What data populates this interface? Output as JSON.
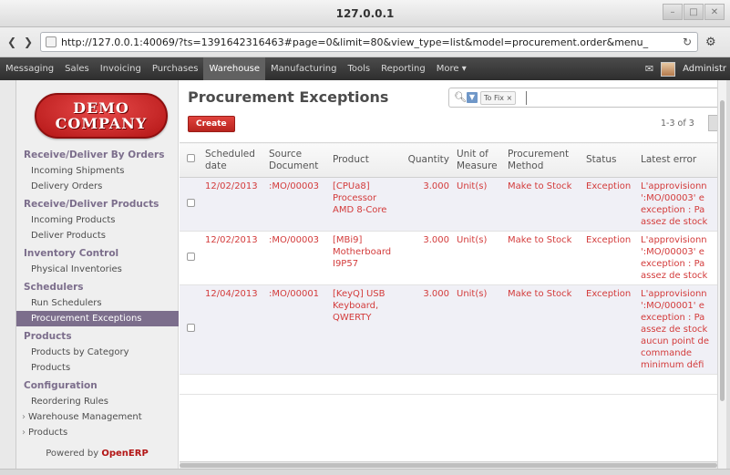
{
  "window": {
    "title": "127.0.0.1"
  },
  "browser": {
    "url": "http://127.0.0.1:40069/?ts=1391642316463#page=0&limit=80&view_type=list&model=procurement.order&menu_"
  },
  "topmenu": {
    "items": [
      {
        "label": "Messaging",
        "active": false
      },
      {
        "label": "Sales",
        "active": false
      },
      {
        "label": "Invoicing",
        "active": false
      },
      {
        "label": "Purchases",
        "active": false
      },
      {
        "label": "Warehouse",
        "active": true
      },
      {
        "label": "Manufacturing",
        "active": false
      },
      {
        "label": "Tools",
        "active": false
      },
      {
        "label": "Reporting",
        "active": false
      },
      {
        "label": "More ▾",
        "active": false
      }
    ],
    "user": "Administr"
  },
  "logo": {
    "line1": "DEMO",
    "line2": "COMPANY"
  },
  "sidebar": {
    "sections": [
      {
        "title": "Receive/Deliver By Orders",
        "items": [
          {
            "label": "Incoming Shipments"
          },
          {
            "label": "Delivery Orders"
          }
        ]
      },
      {
        "title": "Receive/Deliver Products",
        "items": [
          {
            "label": "Incoming Products"
          },
          {
            "label": "Deliver Products"
          }
        ]
      },
      {
        "title": "Inventory Control",
        "items": [
          {
            "label": "Physical Inventories"
          }
        ]
      },
      {
        "title": "Schedulers",
        "items": [
          {
            "label": "Run Schedulers"
          },
          {
            "label": "Procurement Exceptions",
            "active": true
          }
        ]
      },
      {
        "title": "Products",
        "items": [
          {
            "label": "Products by Category"
          },
          {
            "label": "Products"
          }
        ]
      },
      {
        "title": "Configuration",
        "items": [
          {
            "label": "Reordering Rules"
          },
          {
            "label": "Warehouse Management",
            "arrow": true
          },
          {
            "label": "Products",
            "arrow": true
          }
        ]
      }
    ],
    "powered_prefix": "Powered by ",
    "powered_brand": "OpenERP"
  },
  "main": {
    "title": "Procurement Exceptions",
    "search": {
      "facet": "To Fix ×",
      "filter_icon": "filter-icon"
    },
    "create_label": "Create",
    "pager": "1-3 of 3"
  },
  "table": {
    "columns": [
      "Scheduled date",
      "Source Document",
      "Product",
      "Quantity",
      "Unit of Measure",
      "Procurement Method",
      "Status",
      "Latest error"
    ],
    "rows": [
      {
        "date": "12/02/2013",
        "source": ":MO/00003",
        "product": "[CPUa8]\nProcessor\nAMD 8-Core",
        "qty": "3.000",
        "uom": "Unit(s)",
        "method": "Make to Stock",
        "status": "Exception",
        "error": "L'approvisionn\n':MO/00003' e\nexception : Pa\nassez de stock"
      },
      {
        "date": "12/02/2013",
        "source": ":MO/00003",
        "product": "[MBi9]\nMotherboard\nI9P57",
        "qty": "3.000",
        "uom": "Unit(s)",
        "method": "Make to Stock",
        "status": "Exception",
        "error": "L'approvisionn\n':MO/00003' e\nexception : Pa\nassez de stock"
      },
      {
        "date": "12/04/2013",
        "source": ":MO/00001",
        "product": "[KeyQ] USB\nKeyboard,\nQWERTY",
        "qty": "3.000",
        "uom": "Unit(s)",
        "method": "Make to Stock",
        "status": "Exception",
        "error": "L'approvisionn\n':MO/00001' e\nexception : Pa\nassez de stock\naucun point de\ncommande\nminimum défi"
      }
    ]
  }
}
